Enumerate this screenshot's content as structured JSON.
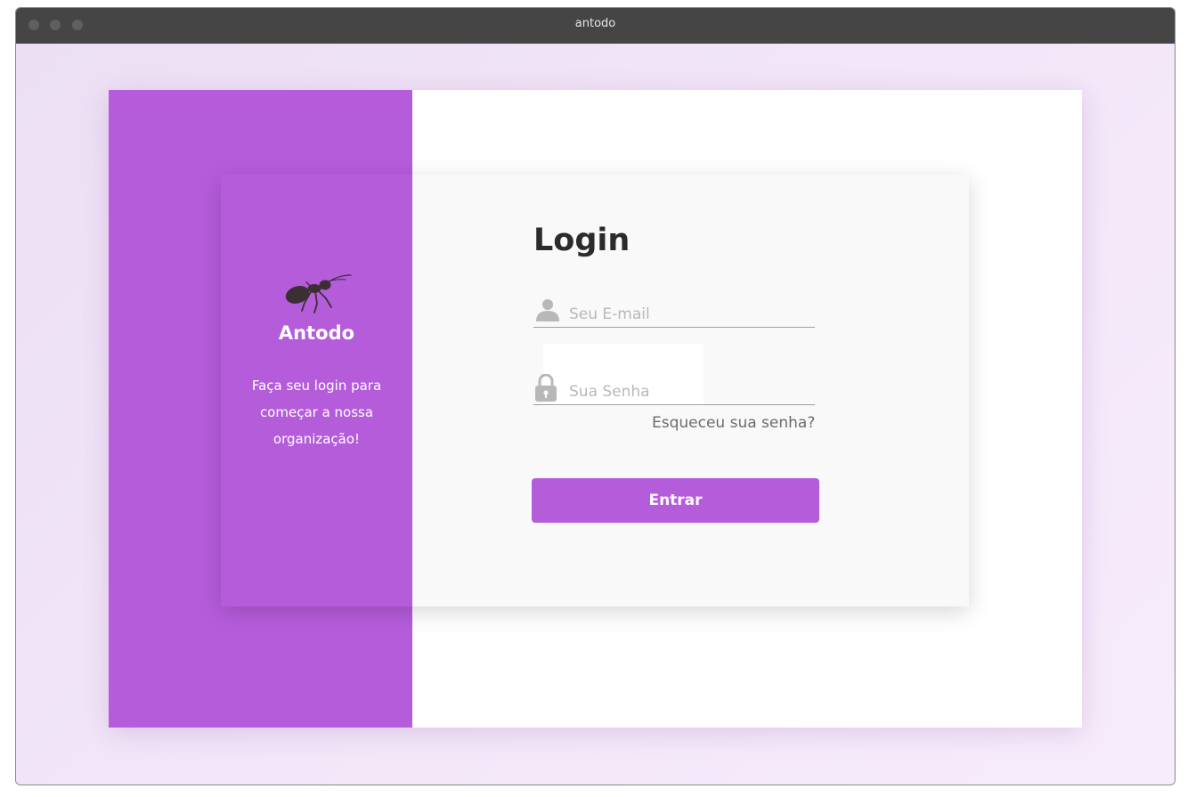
{
  "window": {
    "title": "antodo"
  },
  "brand": {
    "name": "Antodo",
    "tagline": "Faça seu login para começar a nossa organização!",
    "logo_icon": "ant-icon",
    "accent_color": "#b55cdb"
  },
  "login": {
    "title": "Login",
    "email": {
      "icon": "user-icon",
      "placeholder": "Seu E-mail",
      "value": ""
    },
    "password": {
      "icon": "lock-icon",
      "placeholder": "Sua Senha",
      "value": ""
    },
    "forgot_label": "Esqueceu sua senha?",
    "submit_label": "Entrar"
  }
}
